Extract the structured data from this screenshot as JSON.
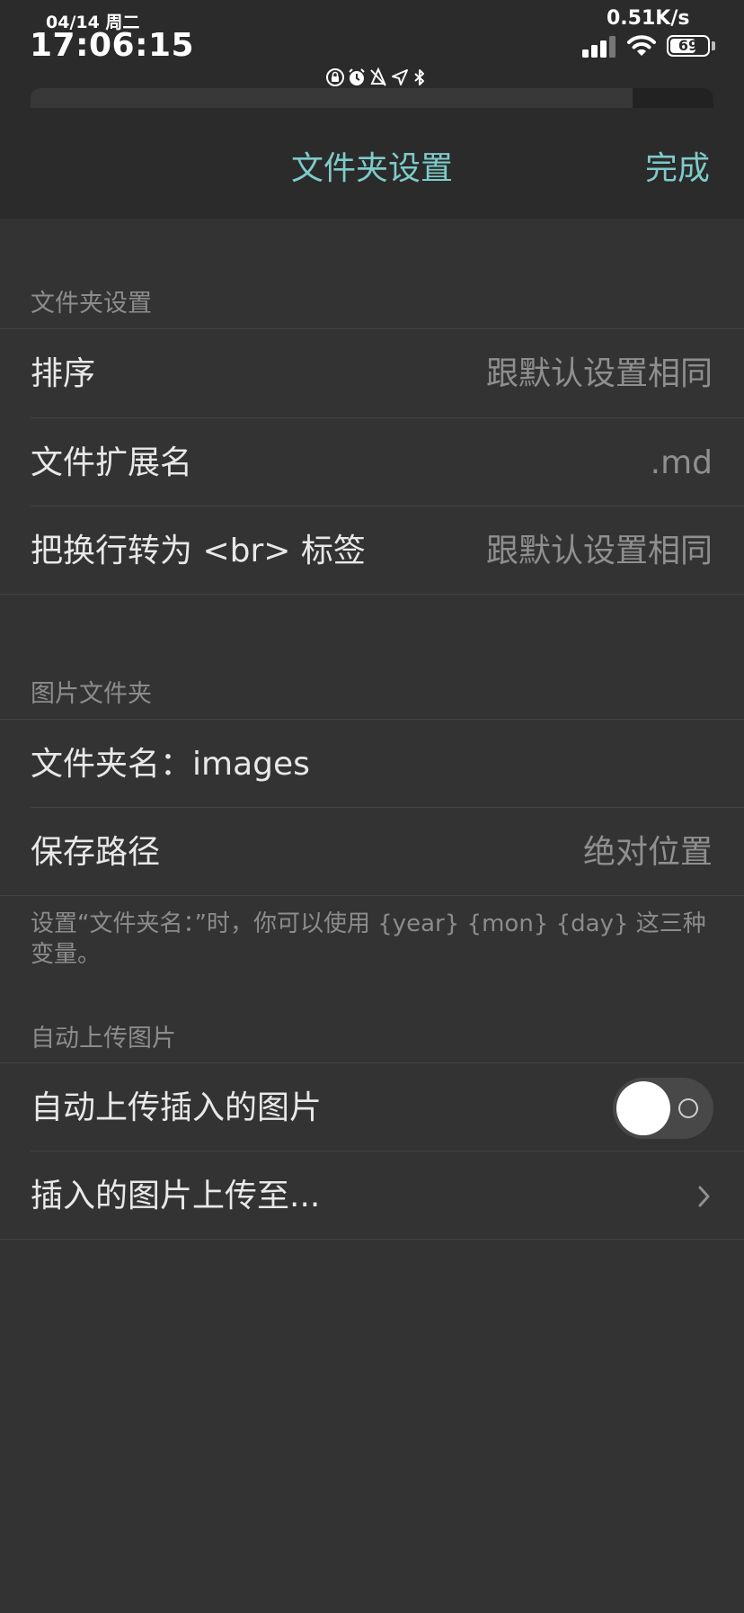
{
  "status_bar": {
    "date": "04/14 周二",
    "time": "17:06:15",
    "net_speed": "0.51K/s",
    "battery_level": "69",
    "battery_percent": 69,
    "icons": [
      "orientation-lock-icon",
      "alarm-icon",
      "no-sound-icon",
      "location-icon",
      "bluetooth-icon"
    ]
  },
  "nav": {
    "title": "文件夹设置",
    "done_label": "完成"
  },
  "sections": {
    "folder": {
      "header": "文件夹设置",
      "rows": [
        {
          "label": "排序",
          "value": "跟默认设置相同"
        },
        {
          "label": "文件扩展名",
          "value": ".md"
        },
        {
          "label": "把换行转为 <br> 标签",
          "value": "跟默认设置相同"
        }
      ]
    },
    "image_folder": {
      "header": "图片文件夹",
      "folder_name_label": "文件夹名：",
      "folder_name_value": "images",
      "save_path_label": "保存路径",
      "save_path_value": "绝对位置",
      "footer": "设置“文件夹名：”时，你可以使用 {year} {mon} {day} 这三种变量。"
    },
    "auto_upload": {
      "header": "自动上传图片",
      "toggle_label": "自动上传插入的图片",
      "toggle_on": false,
      "upload_target_label": "插入的图片上传至..."
    }
  },
  "colors": {
    "accent": "#7ecbc9",
    "background": "#333333",
    "nav_background": "#2b2b2b",
    "secondary_text": "#8f8f8f"
  }
}
